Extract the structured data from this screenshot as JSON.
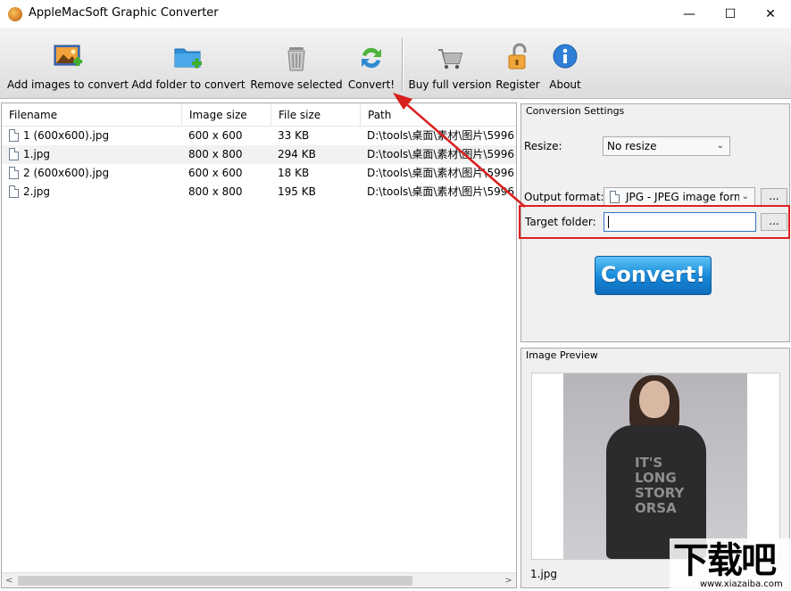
{
  "window": {
    "title": "AppleMacSoft Graphic Converter",
    "min_glyph": "—",
    "max_glyph": "☐",
    "close_glyph": "✕"
  },
  "toolbar": {
    "add_images": "Add images to convert",
    "add_folder": "Add folder to convert",
    "remove_selected": "Remove selected",
    "convert": "Convert!",
    "buy_full": "Buy full version",
    "register": "Register",
    "about": "About"
  },
  "file_list": {
    "columns": [
      "Filename",
      "Image size",
      "File size",
      "Path"
    ],
    "rows": [
      {
        "filename": "1 (600x600).jpg",
        "image_size": "600 x 600",
        "file_size": "33 KB",
        "path": "D:\\tools\\桌面\\素材\\图片\\5996"
      },
      {
        "filename": "1.jpg",
        "image_size": "800 x 800",
        "file_size": "294 KB",
        "path": "D:\\tools\\桌面\\素材\\图片\\5996"
      },
      {
        "filename": "2 (600x600).jpg",
        "image_size": "600 x 600",
        "file_size": "18 KB",
        "path": "D:\\tools\\桌面\\素材\\图片\\5996"
      },
      {
        "filename": "2.jpg",
        "image_size": "800 x 800",
        "file_size": "195 KB",
        "path": "D:\\tools\\桌面\\素材\\图片\\5996"
      }
    ]
  },
  "conversion_settings": {
    "title": "Conversion Settings",
    "resize_label": "Resize:",
    "resize_value": "No resize",
    "output_format_label": "Output format:",
    "output_format_value": "JPG - JPEG image form",
    "browse_label": "...",
    "target_folder_label": "Target folder:",
    "target_folder_value": "",
    "convert_button": "Convert!"
  },
  "image_preview": {
    "title": "Image Preview",
    "filename": "1.jpg",
    "shirt_print": "IT'S LONG STORY ORSA"
  },
  "watermark": {
    "main": "下载吧",
    "sub": "www.xiazaiba.com"
  },
  "colors": {
    "highlight_box": "#e02020",
    "annotation_arrow": "#d9201f",
    "convert_button": "#1687d8"
  }
}
